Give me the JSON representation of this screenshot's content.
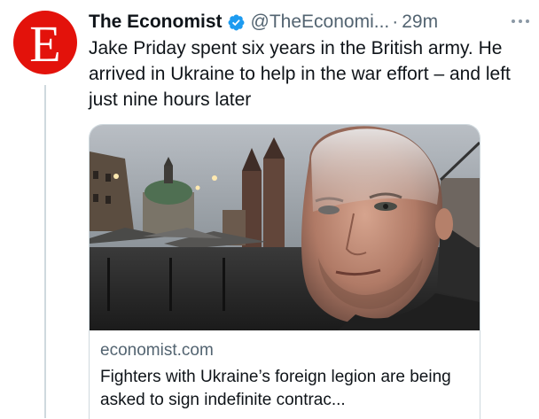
{
  "tweet": {
    "author": {
      "avatar_letter": "E",
      "display_name": "The Economist",
      "handle": "@TheEconomi...",
      "verified": true
    },
    "separator": "·",
    "timestamp": "29m",
    "text": "Jake Priday spent six years in the British army. He arrived in Ukraine to help in the war effort – and left just nine hours later"
  },
  "card": {
    "domain": "economist.com",
    "title": "Fighters with Ukraine’s foreign legion are being asked to sign indefinite contrac..."
  },
  "icons": {
    "verified": "verified-badge-icon",
    "more": "more-options-icon"
  },
  "colors": {
    "brand": "#e3120b",
    "verified": "#1d9bf0",
    "secondary_text": "#536471",
    "border": "#cfd9de"
  }
}
